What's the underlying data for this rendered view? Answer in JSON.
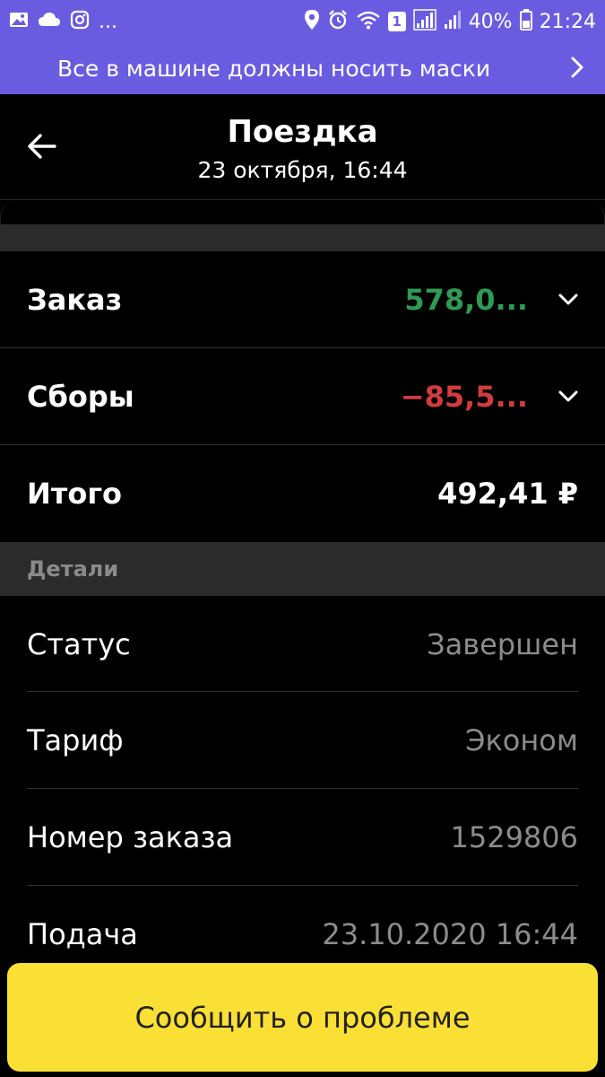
{
  "status_bar": {
    "battery_percent": "40%",
    "time": "21:24",
    "dots": "...",
    "sim_badge": "1",
    "icons": [
      "image-icon",
      "cloud-icon",
      "instagram-icon",
      "location-icon",
      "alarm-icon",
      "wifi-icon",
      "signal-icon",
      "signal-icon",
      "battery-icon"
    ]
  },
  "banner": {
    "text": "Все в машине должны носить маски"
  },
  "header": {
    "title": "Поездка",
    "subtitle": "23 октября, 16:44"
  },
  "summary": {
    "order_label": "Заказ",
    "order_value": "578,0...",
    "fees_label": "Сборы",
    "fees_value": "−85,5...",
    "total_label": "Итого",
    "total_value": "492,41 ₽"
  },
  "details": {
    "heading": "Детали",
    "rows": [
      {
        "label": "Статус",
        "value": "Завершен"
      },
      {
        "label": "Тариф",
        "value": "Эконом"
      },
      {
        "label": "Номер заказа",
        "value": "1529806"
      },
      {
        "label": "Подача",
        "value": "23.10.2020 16:44"
      }
    ]
  },
  "cta": {
    "label": "Сообщить о проблеме"
  },
  "colors": {
    "banner_bg": "#6a5ce0",
    "positive": "#2e9b55",
    "negative": "#d23c3c",
    "cta_bg": "#fae035"
  }
}
